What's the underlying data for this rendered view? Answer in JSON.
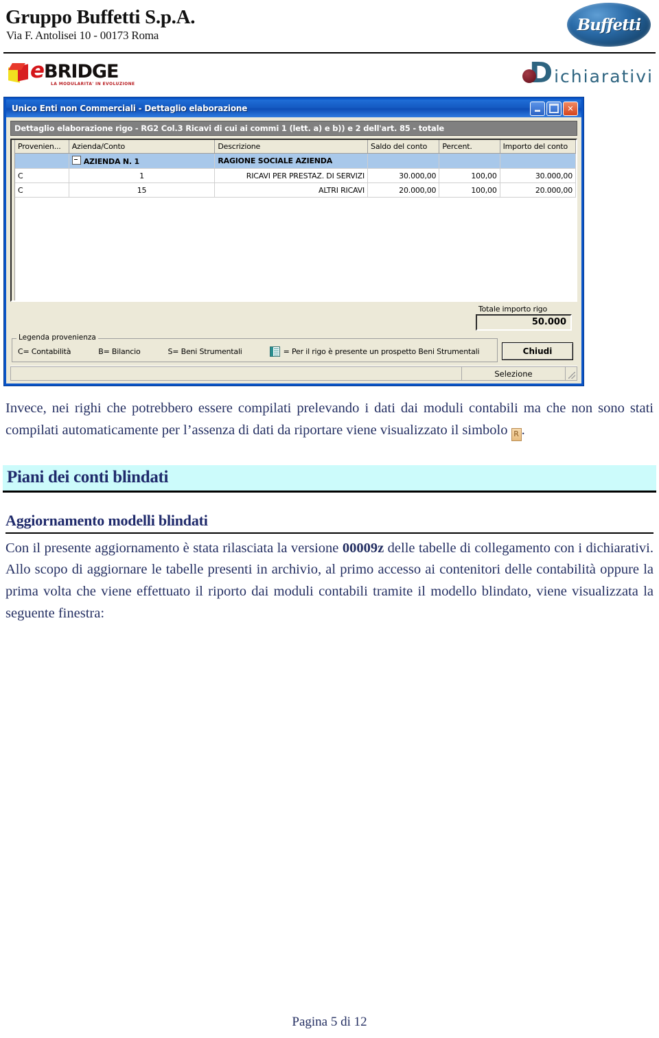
{
  "header": {
    "company": "Gruppo Buffetti S.p.A.",
    "address": "Via F. Antolisei 10 - 00173 Roma",
    "buffetti_logo_text": "Buffetti",
    "ebridge": {
      "e": "e",
      "bridge": "BRIDGE",
      "tagline": "LA MODULARITA' IN EVOLUZIONE"
    },
    "dichiarativi": {
      "initial": "D",
      "rest": "ichiarativi"
    }
  },
  "dialog": {
    "title": "Unico Enti non Commerciali - Dettaglio elaborazione",
    "subtitle": "Dettaglio elaborazione rigo - RG2 Col.3 Ricavi di cui ai commi 1 (lett. a) e b)) e 2 dell'art. 85 - totale",
    "window_buttons": {
      "minimize": "minimize-button",
      "maximize": "maximize-button",
      "close": "✕"
    },
    "grid": {
      "columns": [
        "Provenien...",
        "Azienda/Conto",
        "Descrizione",
        "Saldo del conto",
        "Percent.",
        "Importo del conto"
      ],
      "group_row": {
        "provenienza": "",
        "azienda_conto": "AZIENDA N. 1",
        "descrizione": "RAGIONE SOCIALE AZIENDA",
        "saldo": "",
        "percent": "",
        "importo": ""
      },
      "rows": [
        {
          "provenienza": "C",
          "azienda_conto": "1",
          "descrizione": "RICAVI PER PRESTAZ. DI SERVIZI",
          "saldo": "30.000,00",
          "percent": "100,00",
          "importo": "30.000,00"
        },
        {
          "provenienza": "C",
          "azienda_conto": "15",
          "descrizione": "ALTRI RICAVI",
          "saldo": "20.000,00",
          "percent": "100,00",
          "importo": "20.000,00"
        }
      ]
    },
    "total": {
      "label": "Totale importo rigo",
      "value": "50.000"
    },
    "legend": {
      "title": "Legenda provenienza",
      "items": [
        "C= Contabilità",
        "B= Bilancio",
        "S= Beni Strumentali"
      ],
      "icon_item": "= Per il rigo è presente un prospetto Beni Strumentali"
    },
    "close_button": "Chiudi",
    "status": {
      "selection": "Selezione"
    }
  },
  "body": {
    "paragraph1_part1": "Invece, nei righi che potrebbero essere compilati prelevando i dati dai moduli contabili ma che non sono stati compilati automaticamente per l’assenza di dati da riportare viene visualizzato il simbolo ",
    "r_symbol": "R",
    "paragraph1_part2": ".",
    "heading1": "Piani dei conti blindati",
    "heading2": "Aggiornamento modelli blindati",
    "paragraph2_part1": "Con il presente aggiornamento è stata rilasciata la versione ",
    "version": "00009z",
    "paragraph2_part2": " delle tabelle di collegamento con i dichiarativi. Allo scopo di aggiornare le tabelle presenti in archivio, al primo accesso ai contenitori delle contabilità oppure la prima volta che viene effettuato il riporto dai moduli contabili tramite il modello blindato, viene visualizzata la seguente finestra:"
  },
  "footer": {
    "page_label": "Pagina 5 di 12"
  },
  "colors": {
    "title_bar_blue": "#0d4cb5",
    "dialog_face": "#ece9d8",
    "group_row_blue": "#a8c8ea",
    "heading_highlight": "#ccfbfb",
    "text_navy": "#242f62"
  }
}
